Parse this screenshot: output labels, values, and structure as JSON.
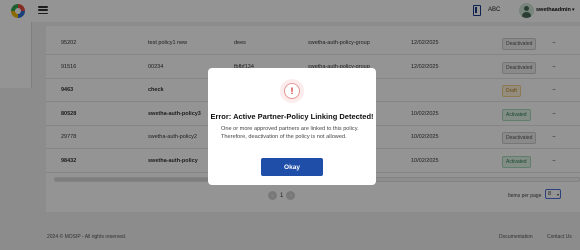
{
  "header": {
    "language": "ABC",
    "username": "swethaadmin",
    "caret": "▾"
  },
  "table": {
    "rows": [
      {
        "id": "95202",
        "name": "test policy1 new",
        "desc": "dees",
        "group": "swetha-auth-policy-group",
        "date": "12/02/2025",
        "status": "Deactivated",
        "status_type": "deactivated",
        "bold": false
      },
      {
        "id": "91516",
        "name": "00234",
        "desc": "fbfbf134",
        "group": "swetha-auth-policy-group",
        "date": "12/02/2025",
        "status": "Deactivated",
        "status_type": "deactivated",
        "bold": false
      },
      {
        "id": "9463",
        "name": "check",
        "desc": "",
        "group": "",
        "date": "",
        "status": "Draft",
        "status_type": "draft",
        "bold": true
      },
      {
        "id": "80528",
        "name": "swetha-auth-policy3",
        "desc": "",
        "group": "",
        "date": "10/02/2025",
        "status": "Activated",
        "status_type": "activated",
        "bold": true
      },
      {
        "id": "29778",
        "name": "swetha-auth-policy2",
        "desc": "",
        "group": "swetha-auth-policy-group",
        "date": "10/02/2025",
        "status": "Deactivated",
        "status_type": "deactivated",
        "bold": false
      },
      {
        "id": "98432",
        "name": "swetha-auth-policy",
        "desc": "",
        "group": "swetha-auth-policy-group",
        "date": "10/02/2025",
        "status": "Activated",
        "status_type": "activated",
        "bold": true
      }
    ],
    "more": "..."
  },
  "pagination": {
    "prev": "‹",
    "page": "1",
    "next": "›",
    "items_per_page_label": "Items per page",
    "items_per_page_value": "8",
    "dropdown_glyph": "▾"
  },
  "footer": {
    "copyright": "2024 © MOSIP - All rights reserved.",
    "documentation": "Documentation",
    "contact": "Contact Us"
  },
  "modal": {
    "icon": "!",
    "title": "Error: Active Partner-Policy Linking Detected!",
    "message": "One or more approved partners are linked to this policy. Therefore, deactivation of the policy is not allowed.",
    "okay_label": "Okay"
  },
  "colors": {
    "primary": "#1f4ea8",
    "error": "#c62828",
    "activated": "#2e7d4f",
    "draft": "#b7791f"
  }
}
